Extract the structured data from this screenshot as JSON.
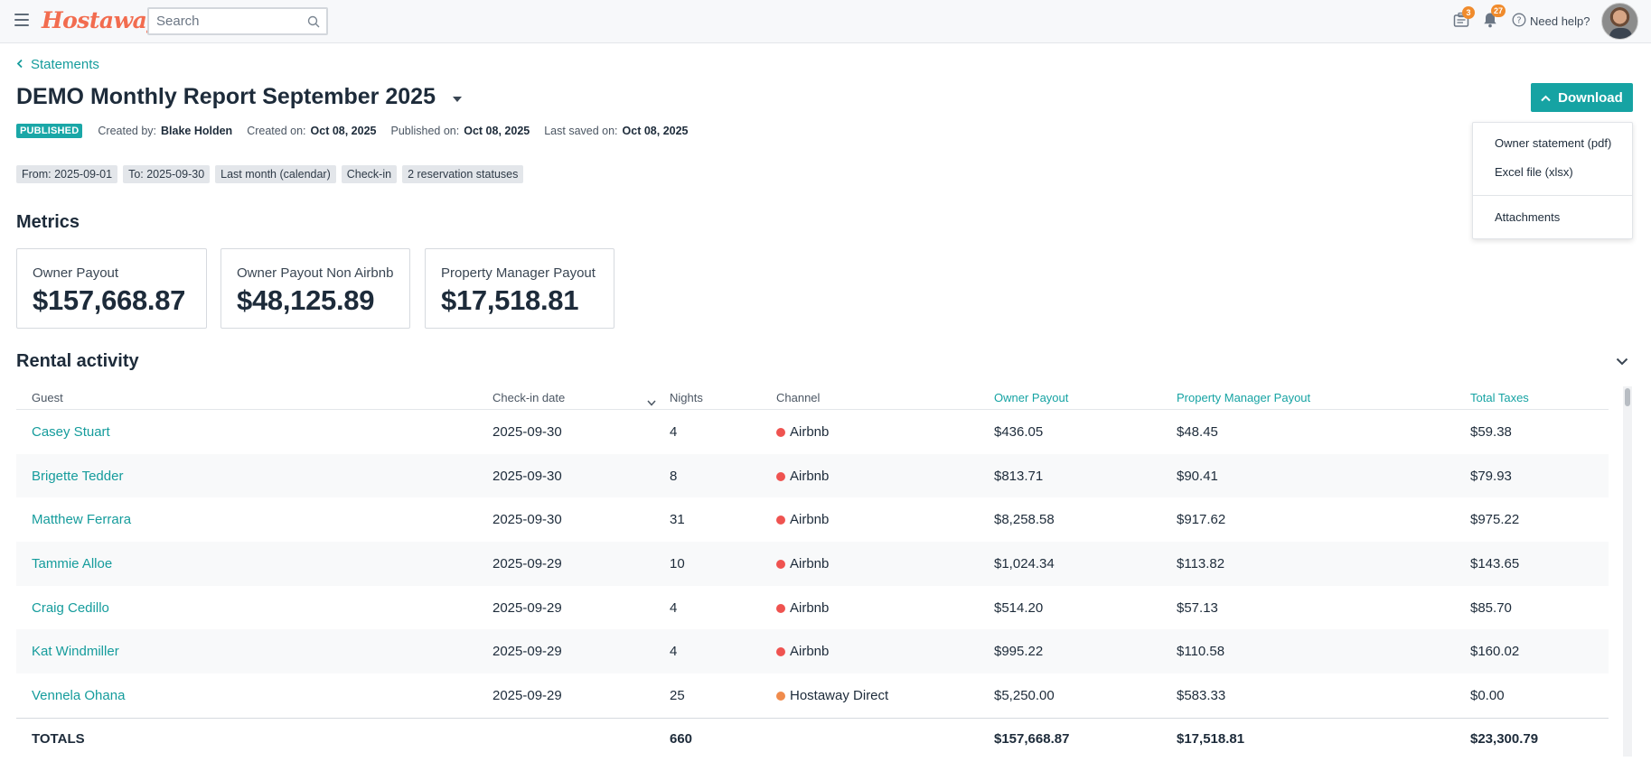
{
  "app": {
    "logo": "Hostaway"
  },
  "search": {
    "placeholder": "Search"
  },
  "notifications": {
    "tasks_count": "3",
    "bell_count": "27"
  },
  "help": {
    "label": "Need help?"
  },
  "breadcrumb": {
    "label": "Statements"
  },
  "report": {
    "title": "DEMO Monthly Report September 2025",
    "status": "PUBLISHED",
    "created_by_label": "Created by:",
    "created_by": "Blake Holden",
    "created_on_label": "Created on:",
    "created_on": "Oct 08, 2025",
    "published_on_label": "Published on:",
    "published_on": "Oct 08, 2025",
    "last_saved_label": "Last saved on:",
    "last_saved": "Oct 08, 2025"
  },
  "filters": [
    "From: 2025-09-01",
    "To: 2025-09-30",
    "Last month (calendar)",
    "Check-in",
    "2 reservation statuses"
  ],
  "download": {
    "label": "Download",
    "menu": [
      "Owner statement (pdf)",
      "Excel file (xlsx)",
      "Attachments"
    ]
  },
  "metrics": {
    "title": "Metrics",
    "cards": [
      {
        "label": "Owner Payout",
        "value": "$157,668.87"
      },
      {
        "label": "Owner Payout Non Airbnb",
        "value": "$48,125.89"
      },
      {
        "label": "Property Manager Payout",
        "value": "$17,518.81"
      }
    ]
  },
  "rental": {
    "title": "Rental activity",
    "columns": [
      "Guest",
      "Check-in date",
      "Nights",
      "Channel",
      "Owner Payout",
      "Property Manager Payout",
      "Total Taxes"
    ],
    "rows": [
      {
        "guest": "Casey Stuart",
        "checkin": "2025-09-30",
        "nights": "4",
        "channel": "Airbnb",
        "channel_color": "#ef5350",
        "owner": "$436.05",
        "pm": "$48.45",
        "taxes": "$59.38"
      },
      {
        "guest": "Brigette Tedder",
        "checkin": "2025-09-30",
        "nights": "8",
        "channel": "Airbnb",
        "channel_color": "#ef5350",
        "owner": "$813.71",
        "pm": "$90.41",
        "taxes": "$79.93"
      },
      {
        "guest": "Matthew Ferrara",
        "checkin": "2025-09-30",
        "nights": "31",
        "channel": "Airbnb",
        "channel_color": "#ef5350",
        "owner": "$8,258.58",
        "pm": "$917.62",
        "taxes": "$975.22"
      },
      {
        "guest": "Tammie Alloe",
        "checkin": "2025-09-29",
        "nights": "10",
        "channel": "Airbnb",
        "channel_color": "#ef5350",
        "owner": "$1,024.34",
        "pm": "$113.82",
        "taxes": "$143.65"
      },
      {
        "guest": "Craig Cedillo",
        "checkin": "2025-09-29",
        "nights": "4",
        "channel": "Airbnb",
        "channel_color": "#ef5350",
        "owner": "$514.20",
        "pm": "$57.13",
        "taxes": "$85.70"
      },
      {
        "guest": "Kat Windmiller",
        "checkin": "2025-09-29",
        "nights": "4",
        "channel": "Airbnb",
        "channel_color": "#ef5350",
        "owner": "$995.22",
        "pm": "$110.58",
        "taxes": "$160.02"
      },
      {
        "guest": "Vennela Ohana",
        "checkin": "2025-09-29",
        "nights": "25",
        "channel": "Hostaway Direct",
        "channel_color": "#f08b4c",
        "owner": "$5,250.00",
        "pm": "$583.33",
        "taxes": "$0.00"
      }
    ],
    "totals": {
      "label": "TOTALS",
      "nights": "660",
      "owner": "$157,668.87",
      "pm": "$17,518.81",
      "taxes": "$23,300.79"
    }
  },
  "colors": {
    "accent": "#16a3a3",
    "brand": "#f26c4f",
    "badge": "#f08b2c",
    "airbnb": "#ef5350",
    "direct": "#f08b4c"
  }
}
